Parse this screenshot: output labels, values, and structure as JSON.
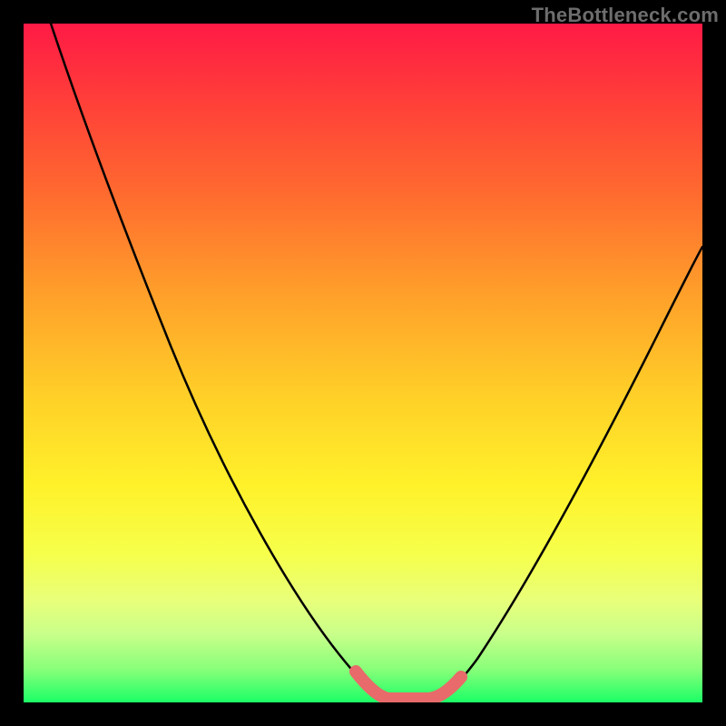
{
  "watermark": {
    "text": "TheBottleneck.com"
  },
  "chart_data": {
    "type": "line",
    "title": "",
    "xlabel": "",
    "ylabel": "",
    "xlim": [
      0,
      100
    ],
    "ylim": [
      0,
      100
    ],
    "series": [
      {
        "name": "bottleneck-curve",
        "x": [
          0,
          6,
          12,
          18,
          24,
          30,
          36,
          42,
          48,
          50,
          54,
          58,
          60,
          66,
          72,
          78,
          84,
          90,
          96,
          100
        ],
        "y": [
          100,
          90,
          79,
          68,
          57,
          47,
          37,
          27,
          13,
          6,
          0,
          0,
          0,
          7,
          17,
          27,
          37,
          46,
          54,
          60
        ]
      },
      {
        "name": "bottom-highlight",
        "x": [
          50,
          54,
          58,
          60
        ],
        "y": [
          6,
          0,
          0,
          0
        ]
      }
    ],
    "annotations": [],
    "gradient_background": {
      "top": "#ff1a46",
      "mid": "#fff12a",
      "bottom": "#1bff66"
    }
  }
}
